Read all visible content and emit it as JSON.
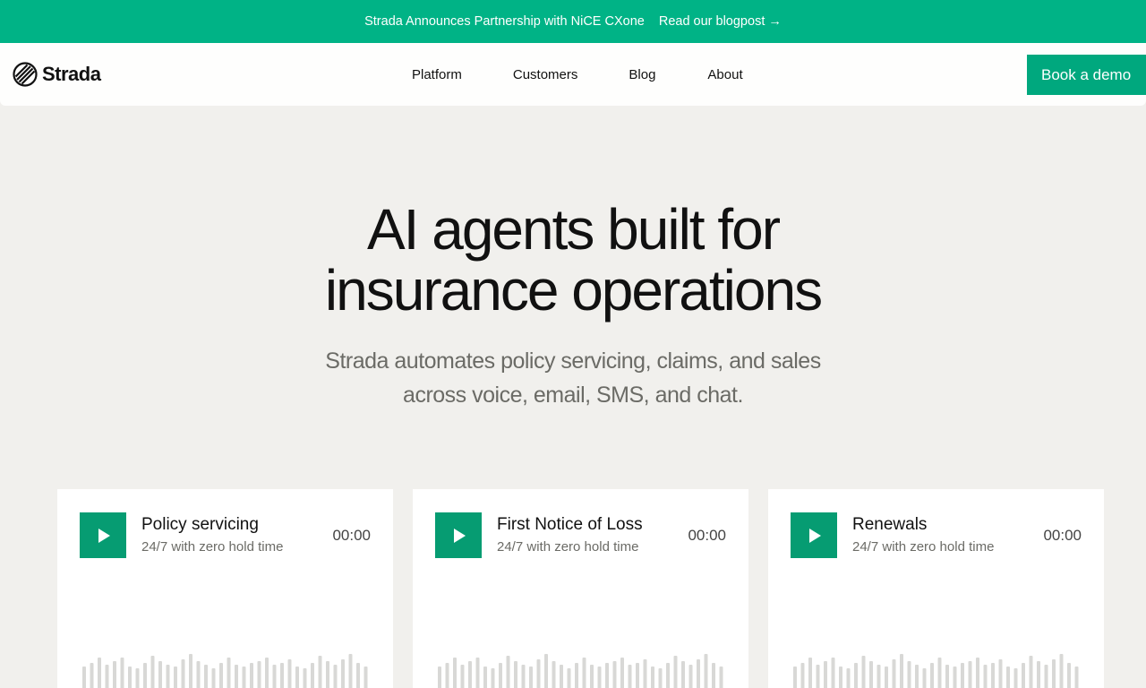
{
  "announcement": {
    "text": "Strada Announces Partnership with NiCE CXone",
    "link": "Read our blogpost →"
  },
  "nav": {
    "logo_text": "Strada",
    "links": [
      "Platform",
      "Customers",
      "Blog",
      "About"
    ],
    "cta": "Book a demo"
  },
  "hero": {
    "title_line1": "AI agents built for",
    "title_line2": "insurance operations",
    "subtitle_line1": "Strada automates policy servicing, claims, and sales",
    "subtitle_line2": "across voice, email, SMS, and chat."
  },
  "cards": [
    {
      "title": "Policy servicing",
      "subtitle": "24/7 with zero hold time",
      "time": "00:00"
    },
    {
      "title": "First Notice of Loss",
      "subtitle": "24/7 with zero hold time",
      "time": "00:00"
    },
    {
      "title": "Renewals",
      "subtitle": "24/7 with zero hold time",
      "time": "00:00"
    }
  ],
  "colors": {
    "brand_green": "#00b386",
    "button_green": "#00a87e",
    "play_green": "#069c72",
    "background": "#f1f0ed"
  },
  "icons": {
    "logo": "strada-logo-icon",
    "play": "play-icon",
    "waveform": "waveform-icon"
  }
}
